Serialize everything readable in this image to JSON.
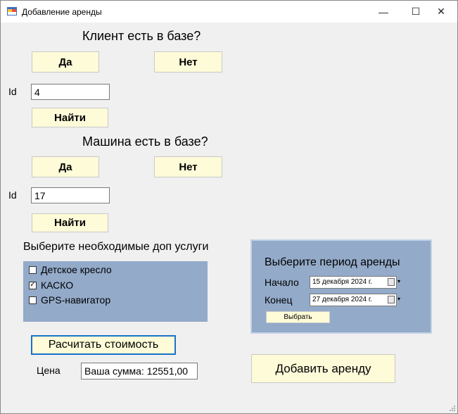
{
  "window": {
    "title": "Добавление аренды",
    "minimize_glyph": "—",
    "maximize_glyph": "☐",
    "close_glyph": "✕"
  },
  "client": {
    "question": "Клиент есть в базе?",
    "yes_label": "Да",
    "no_label": "Нет",
    "id_label": "Id",
    "id_value": "4",
    "find_label": "Найти"
  },
  "car": {
    "question": "Машина есть в базе?",
    "yes_label": "Да",
    "no_label": "Нет",
    "id_label": "Id",
    "id_value": "17",
    "find_label": "Найти"
  },
  "services": {
    "heading": "Выберите необходимые доп услуги",
    "items": [
      {
        "label": "Детское кресло",
        "checked": false,
        "mark": ""
      },
      {
        "label": "КАСКО",
        "checked": true,
        "mark": "✓"
      },
      {
        "label": "GPS-навигатор",
        "checked": false,
        "mark": ""
      }
    ]
  },
  "period": {
    "heading": "Выберите период аренды",
    "start_label": "Начало",
    "start_value": "15  декабря  2024 г.",
    "end_label": "Конец",
    "end_value": "27  декабря  2024 г.",
    "select_label": "Выбрать"
  },
  "pricing": {
    "calc_label": "Расчитать стоимость",
    "price_label": "Цена",
    "price_value": "Ваша сумма: 12551,00"
  },
  "add_rental_label": "Добавить аренду",
  "colors": {
    "button_bg": "#fefbd8",
    "panel_bg": "#93aac9",
    "form_bg": "#f0f0f0"
  }
}
